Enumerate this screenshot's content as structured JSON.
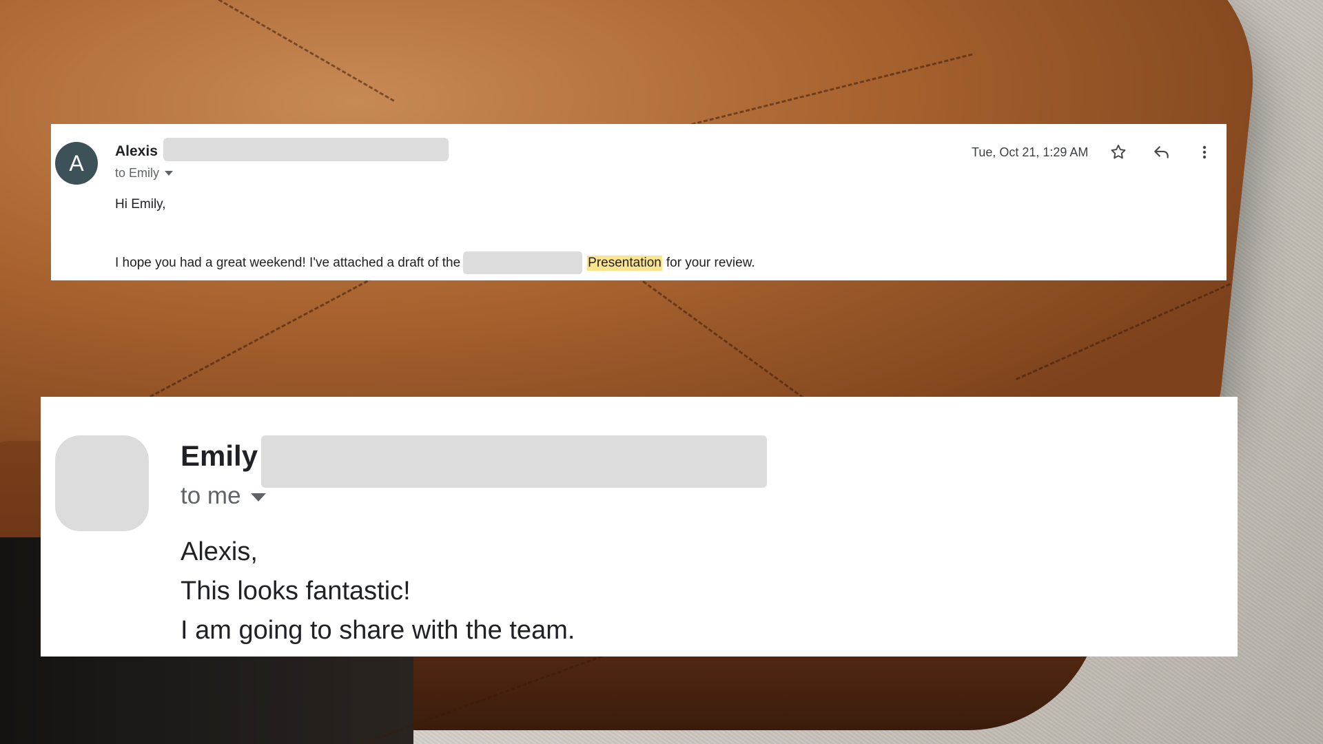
{
  "message1": {
    "avatar_letter": "A",
    "sender_name": "Alexis",
    "recipient_line": "to Emily",
    "date": "Tue, Oct 21, 1:29 AM",
    "greeting": "Hi Emily,",
    "body_before": "I hope you had a great weekend! I've attached a draft of the",
    "highlighted_word": "Presentation",
    "body_after": "for your review.",
    "colors": {
      "avatar_bg": "#3d5258",
      "highlight": "#fbe48e"
    },
    "icons": [
      "star-icon",
      "reply-icon",
      "more-vert-icon"
    ]
  },
  "message2": {
    "sender_name": "Emily",
    "recipient_line": "to me",
    "body_lines": [
      "Alexis,",
      "This looks fantastic!",
      "I am going to share with the team."
    ],
    "icons": [
      "chevron-down-icon"
    ]
  }
}
